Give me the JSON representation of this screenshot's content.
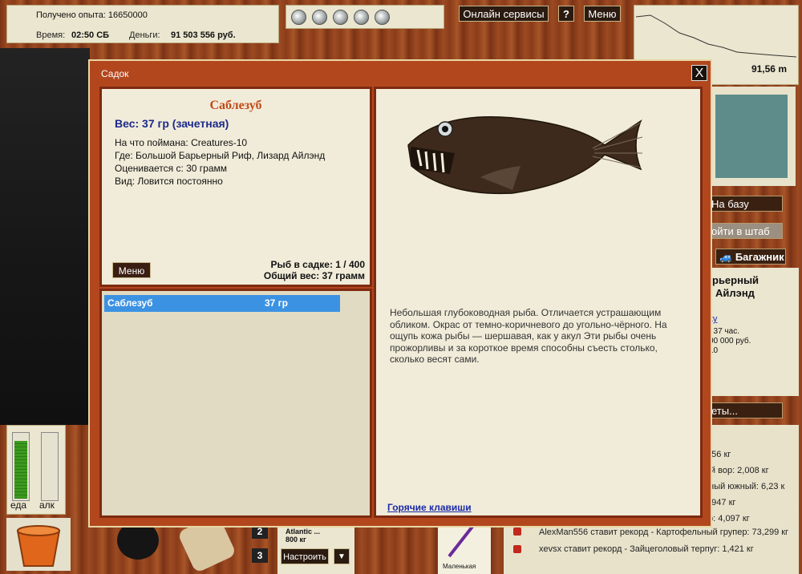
{
  "stats": {
    "experience": "Получено опыта: 16650000",
    "time_label": "Время:",
    "time_value": "02:50 СБ",
    "money_label": "Деньги:",
    "money_value": "91 503 556 руб."
  },
  "topbar": {
    "online_services": "Онлайн сервисы",
    "help": "?",
    "menu": "Меню"
  },
  "depth": {
    "value": "91,56 m"
  },
  "dialog": {
    "title": "Садок",
    "close": "X",
    "fish": {
      "name": "Саблезуб",
      "weight": "Вес: 37 гр (зачетная)",
      "caught_on": "На что поймана: Creatures-10",
      "location": "Где: Большой Барьерный Риф, Лизард Айлэнд",
      "counted_from": "Оценивается с: 30 грамм",
      "kind": "Вид: Ловится постоянно"
    },
    "menu_button": "Меню",
    "fish_count": "Рыб в садке: 1 / 400",
    "total_weight": "Общий вес: 37 грамм",
    "list": [
      {
        "name": "Саблезуб",
        "weight": "37 гр"
      }
    ],
    "description": "Небольшая глубоководная рыба. Отличается устрашающим обликом. Окрас от темно-коричневого до  угольно-чёрного. На ощупь кожа рыбы — шершавая, как у акул Эти рыбы очень прожорливы и за короткое время способны съесть столько, сколько весят сами.",
    "hotkeys": "Горячие клавиши"
  },
  "sidebar": {
    "to_base": "На базу",
    "to_hq": "ойти в штаб",
    "trunk": "Багажник",
    "location_l1": "рьерный",
    "location_l2": "Айлэнд",
    "link": "ку",
    "line1": ": 37 час.",
    "line2": "00 000 руб.",
    "line3": "10",
    "bets": "еты..."
  },
  "records": [
    ",656 кг",
    "ый вор: 2,008 кг",
    "рный южный: 6,23 к",
    "1,947 кг",
    "тр: 4,097 кг",
    "AlexMan556 ставит рекорд - Картофельный групер: 73,299 кг",
    "xevsx ставит рекорд - Зайцеголовый терпуг: 1,421 кг"
  ],
  "meters": {
    "food_label": "еда",
    "alc_label": "алк",
    "food_level": 0.9,
    "alc_level": 0.0
  },
  "bottom": {
    "slot2": "2",
    "slot3": "3",
    "lure_name": "Atlantic ...",
    "lure_weight": "800 кг",
    "configure": "Настроить",
    "dropdown": "▼",
    "spinning_label": "Маленькая"
  }
}
